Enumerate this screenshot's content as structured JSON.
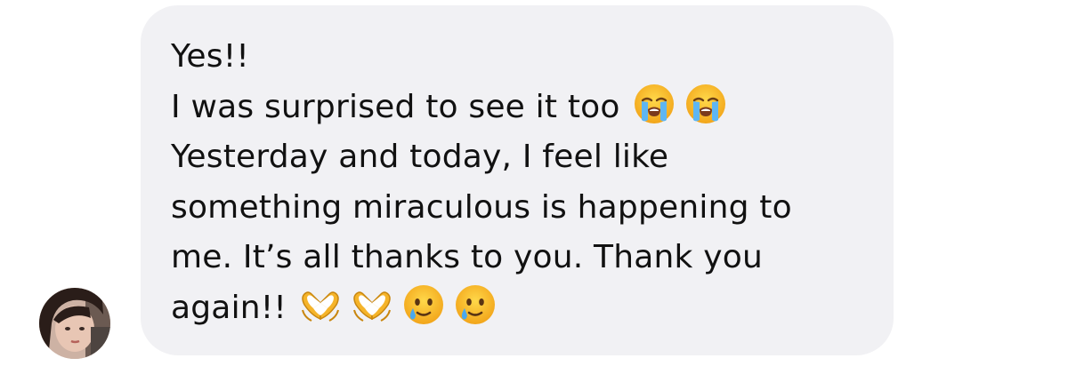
{
  "sender": {
    "avatar_alt": "profile photo"
  },
  "message": {
    "line1": "Yes!!",
    "line2": "I was surprised to see it too",
    "line3": "Yesterday and today, I feel like",
    "line4": "something miraculous is happening to",
    "line5": "me. It’s all thanks to you. Thank you",
    "line6": "again!!"
  },
  "emojis": {
    "line2": [
      "loudly-crying-face",
      "loudly-crying-face"
    ],
    "line6": [
      "heart-hands",
      "heart-hands",
      "smiling-face-with-tear",
      "smiling-face-with-tear"
    ]
  },
  "colors": {
    "bubble_background": "#f1f1f4",
    "text": "#111111",
    "page_background": "#ffffff"
  }
}
